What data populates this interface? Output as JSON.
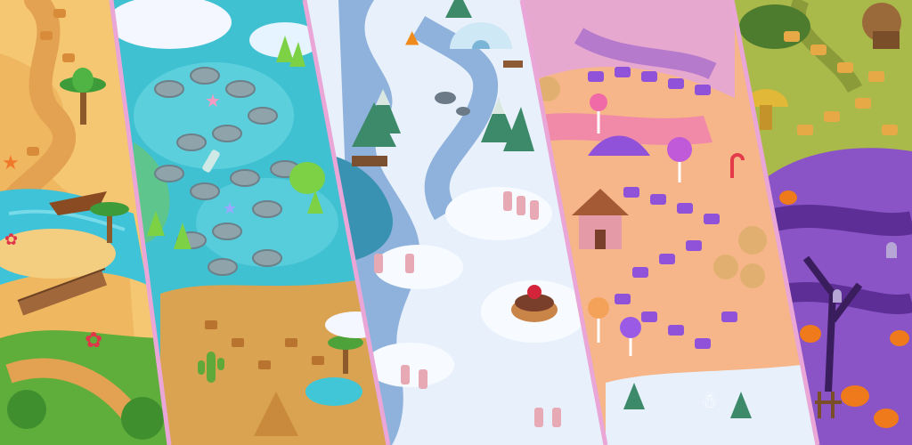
{
  "scene": {
    "panels": [
      {
        "name": "beach-world",
        "theme": "beach",
        "colors": {
          "bg": "#f5c772",
          "water": "#3ec3d8",
          "grass": "#5fae3c",
          "path": "#e8a24a"
        }
      },
      {
        "name": "lagoon-world",
        "theme": "tropical-lagoon",
        "colors": {
          "bg": "#3fc1d2",
          "stones": "#8fa3ab",
          "plants": "#7cd244",
          "sand": "#d9a351"
        }
      },
      {
        "name": "snow-world",
        "theme": "winter",
        "colors": {
          "bg": "#e8f1fb",
          "river": "#8fb2dc",
          "trees": "#3d8a6b",
          "ice": "#bfe2f4"
        }
      },
      {
        "name": "candy-world",
        "theme": "candy",
        "colors": {
          "bg": "#f6b68a",
          "tiles": "#8f52d8",
          "chocolate": "#7a3f2a",
          "pink": "#f0a6c5"
        }
      },
      {
        "name": "halloween-world",
        "theme": "spooky",
        "colors": {
          "bg": "#8a53c6",
          "meadow": "#a9b94a",
          "tiles": "#e7a946",
          "pumpkins": "#ee7a1c"
        }
      }
    ],
    "divider_color": "#e9a6d6"
  }
}
